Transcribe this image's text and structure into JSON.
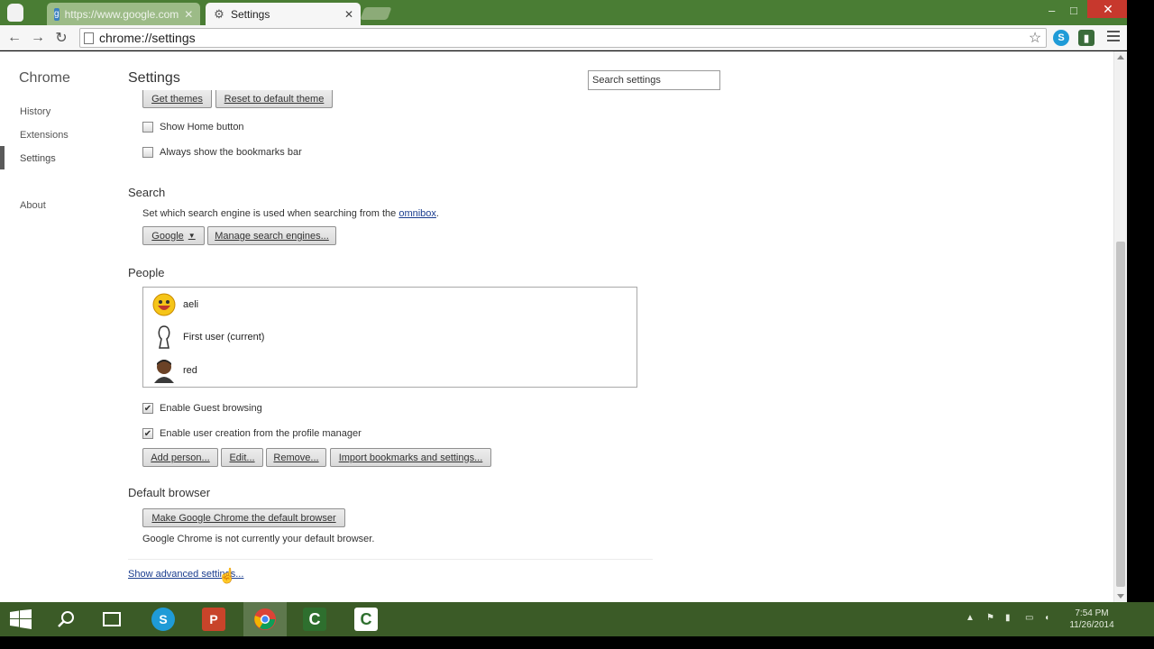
{
  "colors": {
    "frame": "#4a7d34",
    "taskbar": "#3b5b27",
    "link": "#1a3d8f",
    "close_button": "#c7382d"
  },
  "tabs": [
    {
      "label": "https://www.google.com",
      "icon": "google-plus-icon",
      "active": false
    },
    {
      "label": "Settings",
      "icon": "gear-icon",
      "active": true
    }
  ],
  "window_controls": {
    "minimize": "–",
    "maximize": "□",
    "close": "✕"
  },
  "toolbar": {
    "back": "←",
    "forward": "→",
    "reload": "↻",
    "url": "chrome://settings",
    "star": "☆"
  },
  "sidebar": {
    "title": "Chrome",
    "items": [
      {
        "label": "History"
      },
      {
        "label": "Extensions"
      },
      {
        "label": "Settings"
      },
      {
        "label": "About"
      }
    ]
  },
  "settings": {
    "title": "Settings",
    "search_placeholder": "Search settings",
    "appearance": {
      "get_themes": "Get themes",
      "reset_theme": "Reset to default theme",
      "show_home": "Show Home button",
      "show_bookmarks": "Always show the bookmarks bar"
    },
    "search": {
      "title": "Search",
      "desc_prefix": "Set which search engine is used when searching from the ",
      "desc_link": "omnibox",
      "desc_suffix": ".",
      "engine": "Google",
      "manage": "Manage search engines..."
    },
    "people": {
      "title": "People",
      "users": [
        {
          "name": "aeli",
          "avatar": "smiley-avatar-icon"
        },
        {
          "name": "First user (current)",
          "avatar": "silhouette-avatar-icon"
        },
        {
          "name": "red",
          "avatar": "person-avatar-icon"
        }
      ],
      "guest": "Enable Guest browsing",
      "guest_checked": true,
      "user_creation": "Enable user creation from the profile manager",
      "user_creation_checked": true,
      "add": "Add person...",
      "edit": "Edit...",
      "remove": "Remove...",
      "import": "Import bookmarks and settings..."
    },
    "default_browser": {
      "title": "Default browser",
      "button": "Make Google Chrome the default browser",
      "status": "Google Chrome is not currently your default browser."
    },
    "show_advanced": "Show advanced settings..."
  },
  "taskbar": {
    "apps": [
      {
        "name": "start",
        "icon": "windows-icon"
      },
      {
        "name": "search",
        "icon": "search-icon"
      },
      {
        "name": "task-view",
        "icon": "window-icon"
      },
      {
        "name": "skype",
        "icon": "skype-icon",
        "label": "S"
      },
      {
        "name": "powerpoint",
        "icon": "powerpoint-icon",
        "label": "P"
      },
      {
        "name": "chrome",
        "icon": "chrome-icon"
      },
      {
        "name": "camtasia-recorder",
        "icon": "camtasia-icon",
        "label": "C"
      },
      {
        "name": "camtasia-studio",
        "icon": "camtasia-studio-icon",
        "label": "C"
      }
    ],
    "tray_icons": [
      "chevron-up-icon",
      "flag-icon",
      "network-icon",
      "battery-icon",
      "volume-icon",
      "keyboard-icon"
    ],
    "time": "7:54 PM",
    "date": "11/26/2014"
  }
}
